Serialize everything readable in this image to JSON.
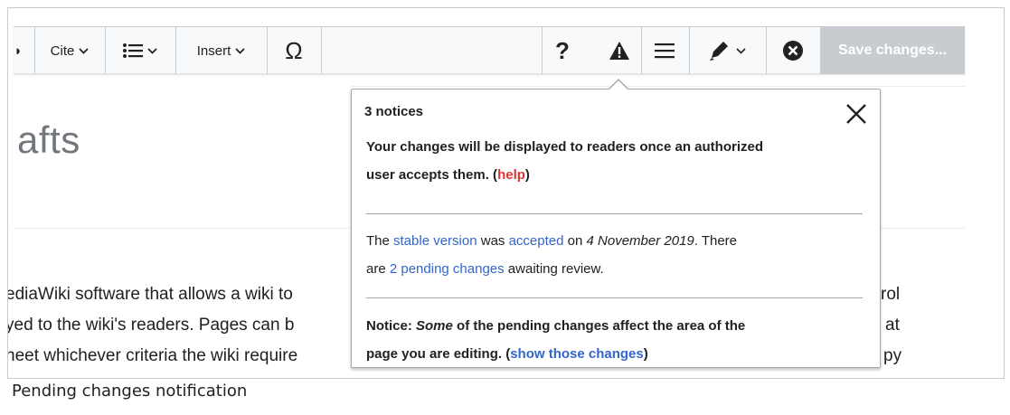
{
  "toolbar": {
    "cite_label": "Cite",
    "insert_label": "Insert",
    "special_char_glyph": "Ω",
    "help_glyph": "?",
    "save_label": "Save changes..."
  },
  "page": {
    "title_fragment": "afts",
    "body_lines": [
      "ediaWiki software that allows a wiki to",
      "yed to the wiki's readers. Pages can b",
      "neet whichever criteria the wiki require"
    ],
    "right_fragments": [
      "rol",
      "at",
      "py"
    ]
  },
  "popup": {
    "title": "3 notices",
    "notice1_bold": "Your changes will be displayed to readers once an authorized",
    "notice1_bold2": "user accepts them. (",
    "notice1_help": "help",
    "notice1_close_paren": ")",
    "notice2": {
      "t1": "The ",
      "link1": "stable version",
      "t2": " was ",
      "link2": "accepted",
      "t3": " on ",
      "date": "4 November 2019",
      "t4": ". There",
      "t5": "are ",
      "link3": "2 pending changes",
      "t6": " awaiting review."
    },
    "notice3": {
      "prefix": "Notice: ",
      "emph": "Some",
      "rest1": " of the pending changes affect the area of the",
      "rest2": "page you are editing.",
      "paren_open": " (",
      "link": "show those changes",
      "paren_close": ")"
    }
  },
  "caption": "Pending changes notification",
  "icons": {
    "chevron": "chevron-down-icon",
    "list": "bulleted-list-icon",
    "warning": "warning-icon",
    "menu": "hamburger-menu-icon",
    "pencil": "pencil-icon",
    "cancel": "cancel-circle-icon",
    "close": "close-icon"
  },
  "colors": {
    "link": "#3366cc",
    "help_link": "#dd3333",
    "save_bg": "#c8ccd1",
    "toolbar_bg": "#f8f9fa"
  }
}
